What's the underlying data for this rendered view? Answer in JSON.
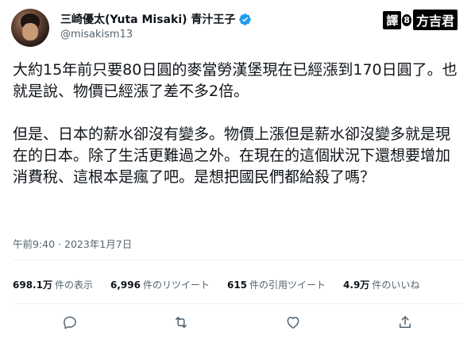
{
  "author": {
    "display_name": "三崎優太(Yuta Misaki) 青汁王子",
    "handle": "@misakism13",
    "verified": true,
    "verified_color": "#1d9bf0"
  },
  "watermark": {
    "prefix": "譯",
    "dot": "8",
    "name": "方吉君"
  },
  "tweet": {
    "paragraphs": [
      "大約15年前只要80日圓的麥當勞漢堡現在已經漲到170日圓了。也就是說、物價已經漲了差不多2倍。",
      "但是、日本的薪水卻沒有變多。物價上漲但是薪水卻沒變多就是現在的日本。除了生活更難過之外。在現在的這個狀況下還想要增加消費稅、這根本是瘋了吧。是想把國民們都給殺了嗎？"
    ]
  },
  "meta": {
    "timestamp": "午前9:40 · 2023年1月7日"
  },
  "stats": [
    {
      "value": "698.1万",
      "label": "件の表示"
    },
    {
      "value": "6,996",
      "label": "件のリツイート"
    },
    {
      "value": "615",
      "label": "件の引用ツイート"
    },
    {
      "value": "4.9万",
      "label": "件のいいね"
    }
  ],
  "actions": [
    "reply-icon",
    "retweet-icon",
    "like-icon",
    "share-icon"
  ],
  "colors": {
    "text": "#0f1419",
    "secondary": "#536471",
    "divider": "#eff3f4"
  }
}
